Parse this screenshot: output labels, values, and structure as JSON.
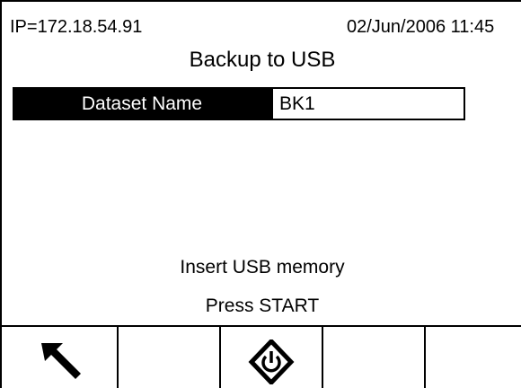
{
  "header": {
    "ip": "IP=172.18.54.91",
    "datetime": "02/Jun/2006 11:45"
  },
  "title": "Backup to USB",
  "dataset": {
    "label": "Dataset Name",
    "value": "BK1"
  },
  "messages": {
    "insert": "Insert USB memory",
    "press": "Press START"
  },
  "softkeys": [
    {
      "icon": "exit-arrow-icon"
    },
    {
      "icon": ""
    },
    {
      "icon": "start-icon"
    },
    {
      "icon": ""
    },
    {
      "icon": ""
    }
  ]
}
